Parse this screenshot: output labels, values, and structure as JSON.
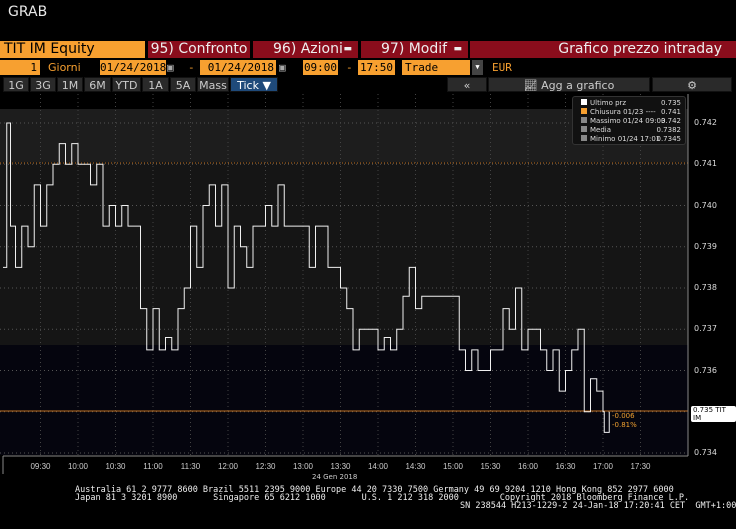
{
  "header": {
    "title": "GRAB",
    "security": "TIT IM Equity",
    "btn95": "95) Confronto",
    "btn96": "96) Azioni",
    "btn97": "97) Modif",
    "chart_title": "Grafico prezzo intraday"
  },
  "controls": {
    "period_count": "1",
    "period_unit": "Giorni",
    "start_date": "01/24/2018",
    "end_date": "01/24/2018",
    "dash": "-",
    "start_time": "09:00",
    "end_time": "17:50",
    "mode": "Trade",
    "currency": "EUR"
  },
  "ranges": [
    "1G",
    "3G",
    "1M",
    "6M",
    "YTD",
    "1A",
    "5A",
    "Mass"
  ],
  "tick_label": "Tick ▼",
  "toolbar": {
    "collapse": "«",
    "add": "Agg a grafico",
    "settings": "⚙"
  },
  "legend": [
    {
      "label": "Ultimo prz",
      "value": "0.735",
      "color": "#ffffff"
    },
    {
      "label": "Chiusura 01/23 ----",
      "value": "0.741",
      "color": "#f7a030"
    },
    {
      "label": "Massimo 01/24 09:03",
      "value": "0.742",
      "color": "#888888"
    },
    {
      "label": "Media",
      "value": "0.7382",
      "color": "#888888"
    },
    {
      "label": "Minimo 01/24 17:01",
      "value": "0.7345",
      "color": "#888888"
    }
  ],
  "last_label": "0.735 TIT IM",
  "change": "-0.006",
  "change_pct": "-0.81%",
  "footer": {
    "line1": "Australia 61 2 9777 8600 Brazil 5511 2395 9000 Europe 44 20 7330 7500 Germany 49 69 9204 1210 Hong Kong 852 2977 6000",
    "line2": "Japan 81 3 3201 8900       Singapore 65 6212 1000       U.S. 1 212 318 2000        Copyright 2018 Bloomberg Finance L.P.",
    "line3": "SN 238544 H213-1229-2 24-Jan-18 17:20:41 CET  GMT+1:00"
  },
  "chart_data": {
    "type": "line",
    "title": "Grafico prezzo intraday",
    "xlabel": "24 Gen 2018",
    "ylabel": "",
    "ylim": [
      0.7335,
      0.7425
    ],
    "xlim": [
      "09:00",
      "17:55"
    ],
    "yticks": [
      "0.734",
      "0.735",
      "0.736",
      "0.737",
      "0.738",
      "0.739",
      "0.740",
      "0.741",
      "0.742"
    ],
    "xticks": [
      "09:30",
      "10:00",
      "10:30",
      "11:00",
      "11:30",
      "12:00",
      "12:30",
      "13:00",
      "13:30",
      "14:00",
      "14:30",
      "15:00",
      "15:30",
      "16:00",
      "16:30",
      "17:00",
      "17:30"
    ],
    "prev_close": 0.741,
    "series": [
      {
        "name": "TIT IM",
        "x": [
          "09:00",
          "09:03",
          "09:06",
          "09:10",
          "09:15",
          "09:20",
          "09:25",
          "09:30",
          "09:35",
          "09:40",
          "09:45",
          "09:50",
          "09:55",
          "10:00",
          "10:10",
          "10:15",
          "10:20",
          "10:25",
          "10:30",
          "10:35",
          "10:40",
          "10:45",
          "10:50",
          "10:55",
          "11:00",
          "11:05",
          "11:10",
          "11:15",
          "11:20",
          "11:25",
          "11:30",
          "11:35",
          "11:40",
          "11:45",
          "11:50",
          "11:55",
          "12:00",
          "12:05",
          "12:10",
          "12:15",
          "12:20",
          "12:25",
          "12:30",
          "12:35",
          "12:40",
          "12:45",
          "12:50",
          "13:00",
          "13:05",
          "13:10",
          "13:20",
          "13:25",
          "13:30",
          "13:35",
          "13:40",
          "13:45",
          "13:50",
          "14:00",
          "14:05",
          "14:10",
          "14:15",
          "14:20",
          "14:25",
          "14:30",
          "14:35",
          "14:45",
          "15:00",
          "15:05",
          "15:10",
          "15:15",
          "15:20",
          "15:30",
          "15:40",
          "15:45",
          "15:50",
          "15:55",
          "16:00",
          "16:10",
          "16:15",
          "16:20",
          "16:25",
          "16:30",
          "16:35",
          "16:40",
          "16:45",
          "16:50",
          "16:55",
          "17:00",
          "17:01",
          "17:05"
        ],
        "y": [
          0.7385,
          0.742,
          0.7395,
          0.7385,
          0.7395,
          0.739,
          0.7405,
          0.7395,
          0.7405,
          0.741,
          0.7415,
          0.741,
          0.7415,
          0.741,
          0.7405,
          0.741,
          0.7395,
          0.74,
          0.7395,
          0.74,
          0.7395,
          0.7395,
          0.7375,
          0.7365,
          0.7375,
          0.7365,
          0.7368,
          0.7365,
          0.7375,
          0.738,
          0.7395,
          0.7385,
          0.74,
          0.7405,
          0.7395,
          0.7405,
          0.738,
          0.7395,
          0.739,
          0.7385,
          0.7395,
          0.7395,
          0.74,
          0.7395,
          0.7405,
          0.7395,
          0.7395,
          0.7395,
          0.7385,
          0.7395,
          0.7385,
          0.7385,
          0.738,
          0.7375,
          0.7365,
          0.737,
          0.737,
          0.7365,
          0.7368,
          0.7365,
          0.737,
          0.7378,
          0.7385,
          0.7375,
          0.7378,
          0.7378,
          0.7378,
          0.7365,
          0.736,
          0.7365,
          0.736,
          0.7365,
          0.7375,
          0.737,
          0.738,
          0.7365,
          0.737,
          0.7365,
          0.736,
          0.7365,
          0.7355,
          0.736,
          0.7365,
          0.737,
          0.735,
          0.7358,
          0.7355,
          0.735,
          0.7345,
          0.735
        ]
      }
    ]
  }
}
